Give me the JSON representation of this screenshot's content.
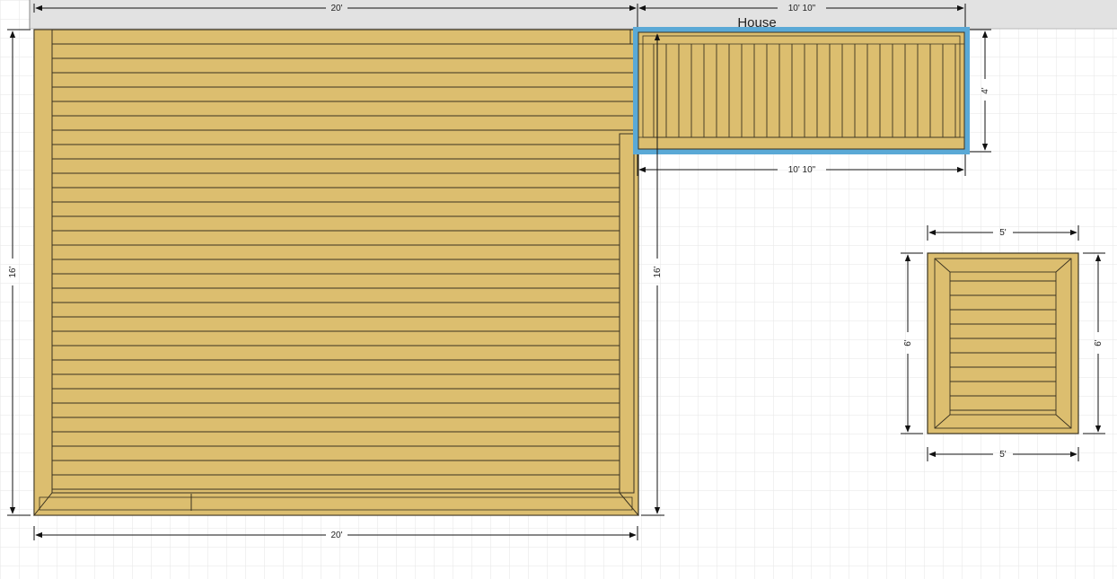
{
  "house": {
    "label": "House"
  },
  "main_deck": {
    "width_top": "20'",
    "width_bottom": "20'",
    "depth_left": "16'",
    "depth_right": "16'"
  },
  "landing_deck": {
    "width_top": "10' 10\"",
    "width_bottom": "10' 10\"",
    "depth": "4'",
    "selected": true
  },
  "small_deck": {
    "width_top": "5'",
    "width_bottom": "5'",
    "depth_left": "6'",
    "depth_right": "6'"
  },
  "colors": {
    "wood": "#dcbe6f",
    "board_line": "#3a3220",
    "selection": "#5aa9d6",
    "house_band": "#e2e2e2",
    "grid": "#e6e6e6"
  }
}
